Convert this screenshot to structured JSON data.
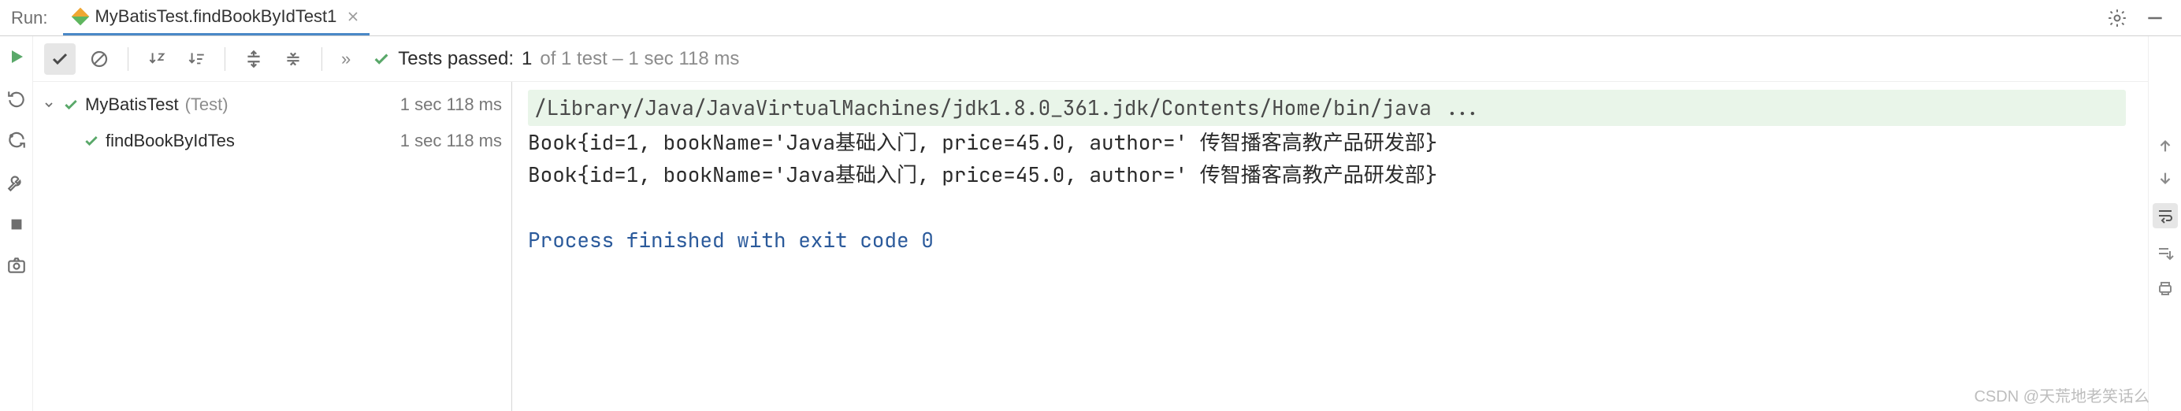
{
  "tabbar": {
    "run_label": "Run:",
    "tab_title": "MyBatisTest.findBookByIdTest1"
  },
  "toolbar": {
    "more": "»"
  },
  "tests": {
    "prefix": "Tests passed:",
    "count": "1",
    "suffix": "of 1 test – 1 sec 118 ms"
  },
  "tree": {
    "root": {
      "name": "MyBatisTest",
      "paren": "(Test)",
      "time": "1 sec 118 ms"
    },
    "child": {
      "name": "findBookByIdTes",
      "time": "1 sec 118 ms"
    }
  },
  "console": {
    "cmd": "/Library/Java/JavaVirtualMachines/jdk1.8.0_361.jdk/Contents/Home/bin/java ...",
    "line1": "Book{id=1, bookName='Java基础入门, price=45.0, author=' 传智播客高教产品研发部}",
    "line2": "Book{id=1, bookName='Java基础入门, price=45.0, author=' 传智播客高教产品研发部}",
    "exit": "Process finished with exit code 0"
  },
  "watermark": "CSDN @天荒地老笑话么"
}
